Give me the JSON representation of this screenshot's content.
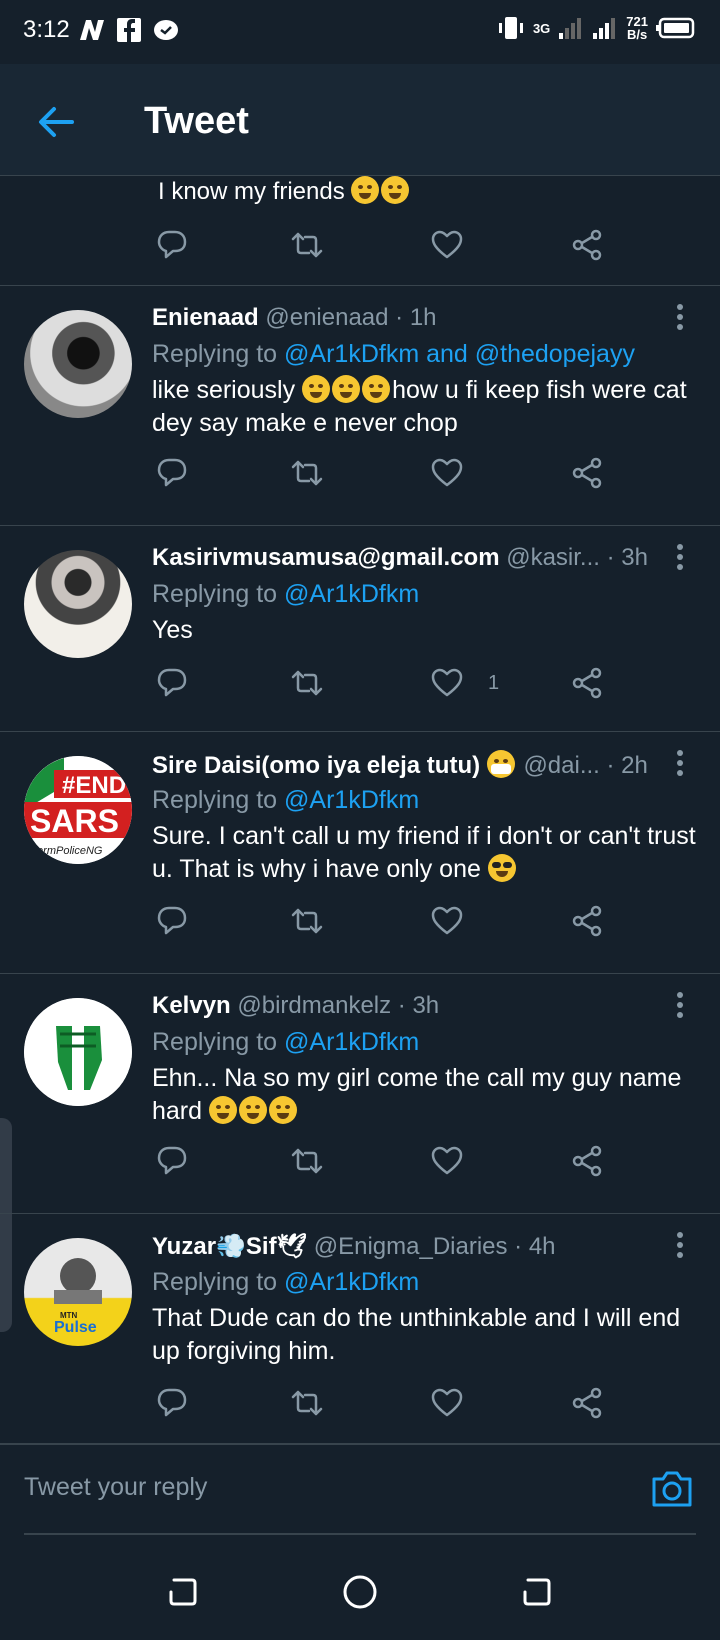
{
  "status_bar": {
    "time": "3:12",
    "network": "3G",
    "speed": "721",
    "speed_unit": "B/s"
  },
  "header": {
    "back_icon": "arrow-left-icon",
    "title": "Tweet"
  },
  "partial_tweet": {
    "text": "I know my friends"
  },
  "tweets": [
    {
      "name": "Enienaad",
      "meta": "@enienaad · 1h",
      "replying_prefix": "Replying to",
      "replying_to": "@Ar1kDfkm and @thedopejayy",
      "body_a": "like seriously",
      "body_b": "how u fi keep fish were cat dey say make e never chop",
      "like_count": ""
    },
    {
      "name": "Kasirivmusamusa@gmail.com",
      "meta": "@kasir... · 3h",
      "replying_prefix": "Replying to",
      "replying_to": "@Ar1kDfkm",
      "body_a": "Yes",
      "body_b": "",
      "like_count": "1"
    },
    {
      "name": "Sire Daisi(omo iya eleja tutu)",
      "meta": "@dai... · 2h",
      "replying_prefix": "Replying to",
      "replying_to": "@Ar1kDfkm",
      "body_a": "Sure. I can't call u my friend if i don't or can't trust u. That is why i have only one",
      "body_b": "",
      "like_count": ""
    },
    {
      "name": "Kelvyn",
      "meta": "@birdmankelz · 3h",
      "replying_prefix": "Replying to",
      "replying_to": "@Ar1kDfkm",
      "body_a": "Ehn... Na so my girl come the call my guy name hard",
      "body_b": "",
      "like_count": ""
    },
    {
      "name": "Yuzar",
      "name_b": "Sif",
      "meta": "@Enigma_Diaries · 4h",
      "replying_prefix": "Replying to",
      "replying_to": "@Ar1kDfkm",
      "body_a": "That Dude can do the unthinkable and I will end up forgiving him.",
      "body_b": "",
      "like_count": ""
    }
  ],
  "avatar_texts": {
    "sars_top": "#END",
    "sars_main": "SARS",
    "sars_bottom": "formPoliceNG",
    "pulse_top": "MTN",
    "pulse_main": "Pulse"
  },
  "composer": {
    "placeholder": "Tweet your reply",
    "camera_icon": "camera-icon"
  },
  "nav": {
    "back_icon": "nav-back-icon",
    "home_icon": "nav-home-icon",
    "recents_icon": "nav-recents-icon"
  },
  "colors": {
    "background": "#15202b",
    "header": "#192734",
    "accent": "#1da1f2",
    "secondary_text": "#8899a6",
    "divider": "#38444d"
  }
}
